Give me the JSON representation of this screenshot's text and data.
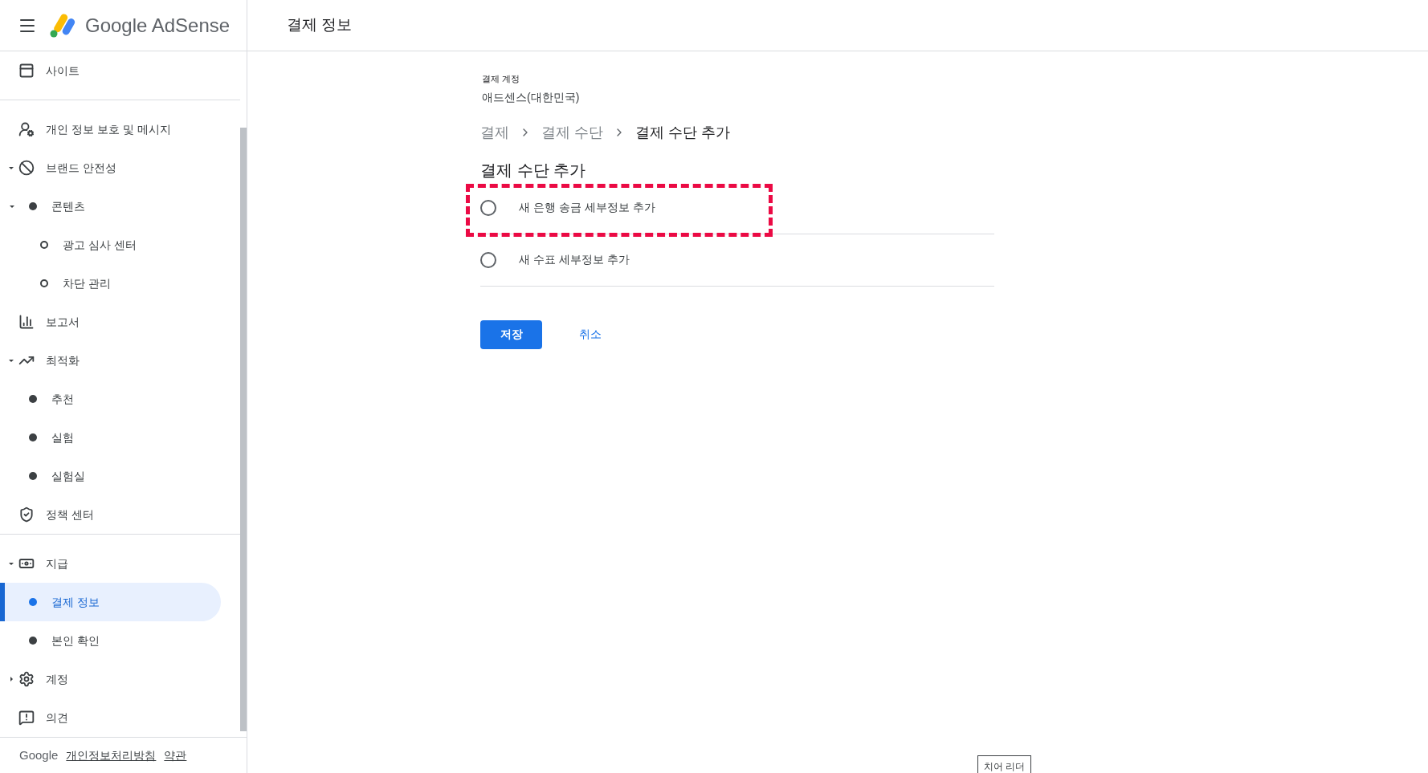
{
  "header": {
    "product": "Google AdSense",
    "page_title": "결제 정보"
  },
  "sidebar": {
    "groups": [
      [
        {
          "label": "사이트",
          "selected": false
        }
      ],
      [
        {
          "label": "개인 정보 보호 및 메시지",
          "selected": false
        },
        {
          "label": "브랜드 안전성",
          "selected": false,
          "expanded": true,
          "children": [
            {
              "label": "콘텐츠",
              "selected": false,
              "expanded": true,
              "children": [
                {
                  "label": "광고 심사 센터",
                  "selected": false
                },
                {
                  "label": "차단 관리",
                  "selected": false
                }
              ]
            }
          ]
        },
        {
          "label": "보고서",
          "selected": false
        },
        {
          "label": "최적화",
          "selected": false,
          "expanded": true,
          "children": [
            {
              "label": "추천",
              "selected": false
            },
            {
              "label": "실험",
              "selected": false
            },
            {
              "label": "실험실",
              "selected": false
            }
          ]
        },
        {
          "label": "정책 센터",
          "selected": false
        }
      ],
      [
        {
          "label": "지급",
          "selected": false,
          "expanded": true,
          "children": [
            {
              "label": "결제 정보",
              "selected": true
            },
            {
              "label": "본인 확인",
              "selected": false
            }
          ]
        },
        {
          "label": "계정",
          "selected": false,
          "expanded": false
        },
        {
          "label": "의견",
          "selected": false
        }
      ]
    ],
    "footer": {
      "brand": "Google",
      "links": [
        "개인정보처리방침",
        "약관"
      ]
    }
  },
  "main": {
    "account_label": "결제 계정",
    "account_name": "애드센스(대한민국)",
    "breadcrumb": [
      {
        "label": "결제",
        "current": false
      },
      {
        "label": "결제 수단",
        "current": false
      },
      {
        "label": "결제 수단 추가",
        "current": true
      }
    ],
    "heading": "결제 수단 추가",
    "options": [
      {
        "label": "새 은행 송금 세부정보 추가",
        "selected": false
      },
      {
        "label": "새 수표 세부정보 추가",
        "selected": false
      }
    ],
    "save_button": "저장",
    "cancel_button": "취소"
  },
  "floating_tag": "치어 리더"
}
